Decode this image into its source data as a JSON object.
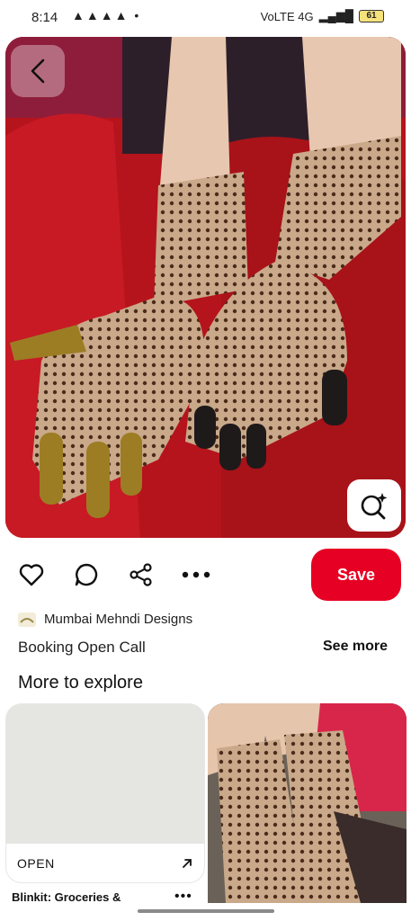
{
  "status_bar": {
    "time": "8:14",
    "notifications": "▲▲▲▲ •",
    "network": "VoLTE 4G",
    "battery": "61"
  },
  "pin": {
    "creator_name": "Mumbai Mehndi Designs",
    "title": "Booking Open Call",
    "see_more": "See more",
    "save_label": "Save"
  },
  "icons": {
    "back": "chevron-left-icon",
    "visual_search": "visual-search-icon",
    "like": "heart-icon",
    "comment": "comment-icon",
    "share": "share-icon",
    "more": "more-icon"
  },
  "explore": {
    "heading": "More to explore",
    "ad_card": {
      "open_label": "OPEN",
      "title": "Blinkit: Groceries &",
      "more": "•••"
    }
  },
  "colors": {
    "accent": "#e60023",
    "hero_bg": "#b5141c"
  }
}
